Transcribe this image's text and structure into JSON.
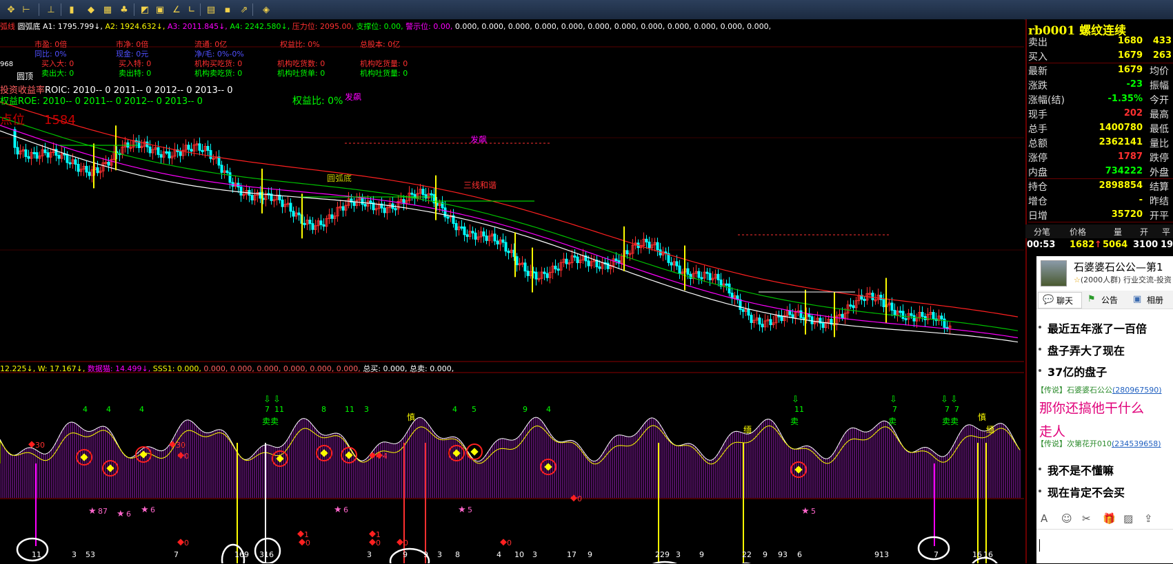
{
  "indicator_line_top": {
    "prefix": "弧线",
    "name": "圆弧底",
    "items": [
      {
        "label": "A1:",
        "value": "1795.799↓",
        "color": "#ffffff"
      },
      {
        "label": "A2:",
        "value": "1924.632↓",
        "color": "#ffff00"
      },
      {
        "label": "A3:",
        "value": "2011.845↓",
        "color": "#ff00ff"
      },
      {
        "label": "A4:",
        "value": "2242.580↓",
        "color": "#00ff00"
      },
      {
        "label": "压力位:",
        "value": "2095.00",
        "color": "#ff3030"
      },
      {
        "label": "支撑位:",
        "value": "0.00",
        "color": "#00ff00"
      },
      {
        "label": "警示位:",
        "value": "0.00",
        "color": "#ff00ff"
      }
    ],
    "trailing": "0.000, 0.000, 0.000, 0.000, 0.000, 0.000, 0.000, 0.000, 0.000, 0.000, 0.000, 0.000,"
  },
  "fundamentals": {
    "row1": [
      "市盈: 0倍",
      "市净: 0倍",
      "流通: 0亿",
      "权益比: 0%",
      "总股本: 0亿"
    ],
    "row2": [
      "同比: 0%",
      "现金: 0元",
      "净/毛: 0%-0%"
    ],
    "row3": [
      "买入大: 0",
      "买入特: 0",
      "机构买吃货: 0",
      "机构吃货数: 0",
      "机构吃货量: 0"
    ],
    "row4": [
      "卖出大: 0",
      "卖出特: 0",
      "机构卖吃货: 0",
      "机构吐货单: 0",
      "机构吐货量: 0"
    ],
    "roic": "ROIC: 2010-- 0   2011-- 0   2012-- 0   2013-- 0",
    "roic_prefix": "投资收益率",
    "roe": "ROE: 2010-- 0   2011-- 0   2012-- 0   2013-- 0",
    "roe_prefix": "权益",
    "equity_ratio": "权益比: 0%",
    "price_tag": "1584",
    "price_tag_prefix": "点位",
    "top_tag": "圆顶",
    "top_value": "968"
  },
  "chart_labels": {
    "fafei": "发飙",
    "yuanhudi": "圆弧底",
    "sanxian": "三线和谐",
    "sell": "卖卖",
    "sell_single": "卖",
    "warn": "慎",
    "warn2": "缅"
  },
  "sub_indicator_line": {
    "prefix": "12.225↓, W: 17.167↓,",
    "label": "数据猫: 14.499↓,",
    "rest": "SSS1: 0.000,",
    "zeros": "0.000, 0.000, 0.000, 0.000, 0.000, 0.000,",
    "total_buy": "总买: 0.000,",
    "total_sell": "总卖: 0.000,"
  },
  "quote_panel": {
    "title": "rb0001 螺纹连续",
    "rows": [
      {
        "label": "卖出",
        "value": "1680",
        "value_color": "#ffff00",
        "right": "433",
        "right_color": "#ffff00"
      },
      {
        "label": "买入",
        "value": "1679",
        "value_color": "#ffff00",
        "right": "263",
        "right_color": "#ffff00"
      },
      {
        "label": "最新",
        "value": "1679",
        "value_color": "#ffff00",
        "label2": "均价"
      },
      {
        "label": "涨跌",
        "value": "-23",
        "value_color": "#00ff00",
        "label2": "振幅"
      },
      {
        "label": "涨幅(结)",
        "value": "-1.35%",
        "value_color": "#00ff00",
        "label2": "今开"
      },
      {
        "label": "现手",
        "value": "202",
        "value_color": "#ff3030",
        "label2": "最高"
      },
      {
        "label": "总手",
        "value": "1400780",
        "value_color": "#ffff00",
        "label2": "最低"
      },
      {
        "label": "总额",
        "value": "2362141",
        "value_color": "#ffff00",
        "label2": "量比"
      },
      {
        "label": "涨停",
        "value": "1787",
        "value_color": "#ff3030",
        "label2": "跌停"
      },
      {
        "label": "内盘",
        "value": "734222",
        "value_color": "#00ff00",
        "label2": "外盘"
      },
      {
        "label": "持仓",
        "value": "2898854",
        "value_color": "#ffff00",
        "label2": "结算"
      },
      {
        "label": "增仓",
        "value": "-",
        "value_color": "#ffff00",
        "label2": "昨结"
      },
      {
        "label": "日增",
        "value": "35720",
        "value_color": "#ffff00",
        "label2": "开平"
      }
    ],
    "tick_header": [
      "分笔",
      "价格",
      "量",
      "开",
      "平"
    ],
    "tick_row": {
      "time": "00:53",
      "price": "1682",
      "arrow": "↑",
      "vol": "5064",
      "open": "3100",
      "close": "19"
    }
  },
  "chat": {
    "group_name": "石婆婆石公公—第1",
    "group_meta": "(2000人群) 行业交流-投资",
    "tabs": [
      "聊天",
      "公告",
      "相册"
    ],
    "messages": [
      {
        "type": "text",
        "text": "最近五年涨了一百倍",
        "color": "#000000"
      },
      {
        "type": "text",
        "text": "盘子弄大了现在",
        "color": "#000000"
      },
      {
        "type": "text",
        "text": "37亿的盘子",
        "color": "#000000"
      },
      {
        "type": "meta",
        "tag": "【传说】",
        "name": "石婆婆石公公",
        "id": "(280967590)"
      },
      {
        "type": "text",
        "text": "那你还搞他干什么",
        "color": "#e0007a"
      },
      {
        "type": "text",
        "text": "走人",
        "color": "#e0007a"
      },
      {
        "type": "meta",
        "tag": "【传说】",
        "name": "次第花开010",
        "id": "(234539658)"
      },
      {
        "type": "text",
        "text": "我不是不懂嘛",
        "color": "#000000"
      },
      {
        "type": "text",
        "text": "现在肯定不会买",
        "color": "#000000"
      }
    ],
    "toolbar_icons": [
      "font-icon",
      "emoji-icon",
      "scissors-icon",
      "gift-icon",
      "image-icon",
      "share-icon"
    ]
  },
  "lower_numbers": {
    "top_row": [
      "4",
      "4",
      "4",
      "7",
      "11",
      "8",
      "11",
      "3",
      "4",
      "5",
      "9",
      "4",
      "11",
      "7",
      "7",
      "7"
    ],
    "bottom_row": [
      "11",
      "3",
      "53",
      "7",
      "16",
      "9",
      "316",
      "3",
      "9",
      "9",
      "3",
      "8",
      "4",
      "10",
      "3",
      "17",
      "9",
      "22",
      "9",
      "3",
      "9",
      "22",
      "9",
      "93",
      "6",
      "913",
      "7",
      "16",
      "16"
    ],
    "diamond_labels": [
      "30",
      "30",
      "0",
      "0",
      "1",
      "0",
      "4",
      "0",
      "4",
      "0",
      "1",
      "0",
      "0"
    ],
    "star_labels": [
      "87",
      "6",
      "6",
      "6",
      "5",
      "5"
    ]
  },
  "toolbar_icons": [
    "cross-icon",
    "tool-icon",
    "line-icon",
    "volume-icon",
    "warning-icon",
    "bars-icon",
    "bell-icon",
    "chart-switch-icon",
    "chart-icon",
    "draw-icon",
    "draw2-icon",
    "doc-icon",
    "image-icon",
    "export-icon",
    "nav-icon"
  ]
}
